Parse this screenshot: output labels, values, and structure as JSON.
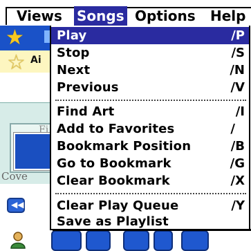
{
  "menubar": {
    "items": [
      {
        "label": "Views"
      },
      {
        "label": "Songs"
      },
      {
        "label": "Options"
      },
      {
        "label": "Help"
      }
    ],
    "active": "Songs"
  },
  "songs_menu": {
    "groups": [
      [
        {
          "label": "Play",
          "shortcut": "∕P"
        },
        {
          "label": "Stop",
          "shortcut": "∕S"
        },
        {
          "label": "Next",
          "shortcut": "∕N"
        },
        {
          "label": "Previous",
          "shortcut": "∕V"
        }
      ],
      [
        {
          "label": "Find Art",
          "shortcut": "∕I"
        },
        {
          "label": "Add to Favorites",
          "shortcut": "∕"
        },
        {
          "label": "Bookmark Position",
          "shortcut": "∕B"
        },
        {
          "label": "Go to Bookmark",
          "shortcut": "∕G"
        },
        {
          "label": "Clear Bookmark",
          "shortcut": "∕X"
        }
      ],
      [
        {
          "label": "Clear Play Queue",
          "shortcut": "∕Y"
        },
        {
          "label": "Save as Playlist",
          "shortcut": ""
        }
      ]
    ],
    "highlighted": "Play"
  },
  "background": {
    "row2_text": "Ai",
    "frame_label": "Fi",
    "cover_label": "Cove"
  },
  "colors": {
    "highlight": "#2a2ba0",
    "accent_blue": "#1f58cf"
  }
}
